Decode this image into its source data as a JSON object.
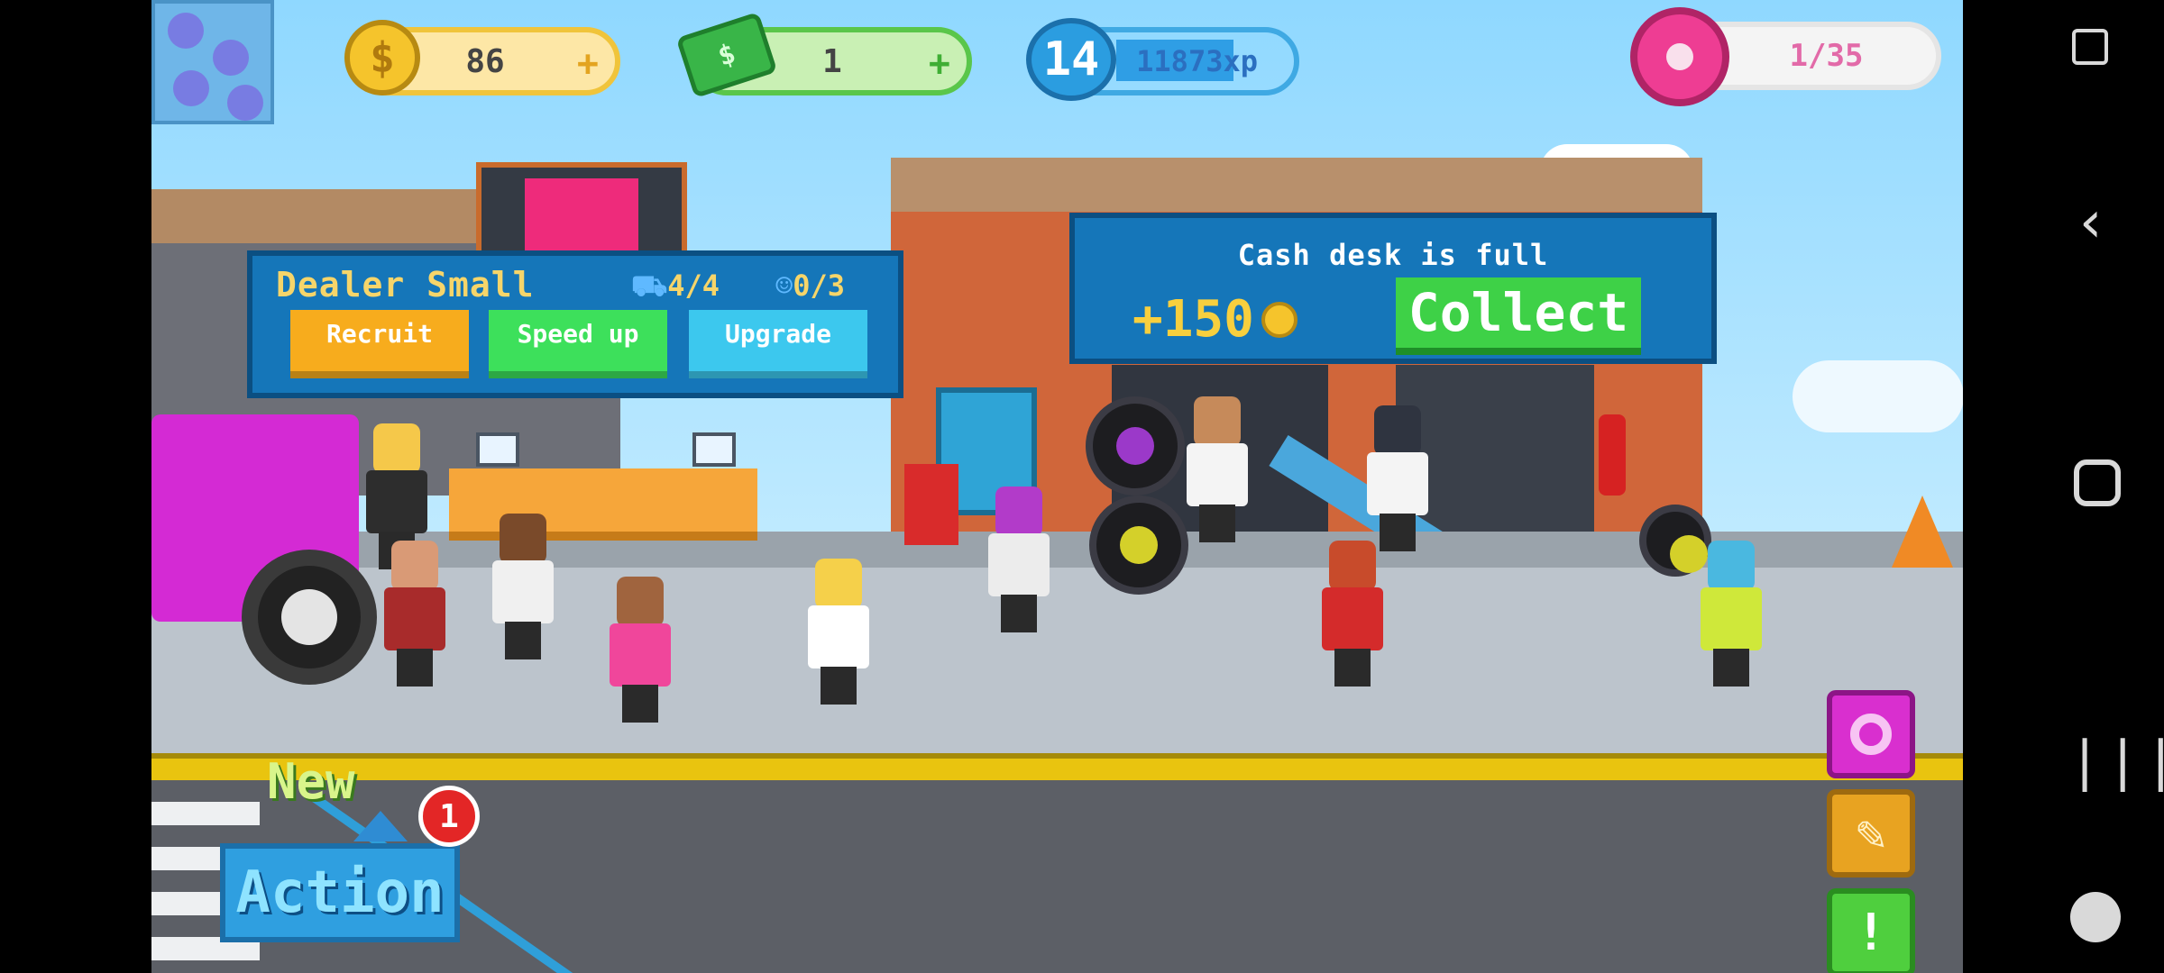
{
  "hud": {
    "coins": "86",
    "coins_plus": "+",
    "cash": "1",
    "cash_plus": "+",
    "level": "14",
    "xp": "11873xp",
    "donuts": "1/35"
  },
  "dealer_panel": {
    "title": "Dealer Small",
    "cars": "4/4",
    "staff": "0/3",
    "recruit": "Recruit",
    "speed_up": "Speed up",
    "upgrade": "Upgrade"
  },
  "cash_desk": {
    "title": "Cash desk is full",
    "amount": "+150",
    "collect": "Collect"
  },
  "action": {
    "new_label": "New",
    "badge": "1",
    "label": "Action"
  },
  "side_buttons": {
    "alert": "!"
  },
  "colors": {
    "panel_blue": "#1576b9",
    "recruit": "#f7ac1d",
    "speed_up": "#3de05b",
    "upgrade": "#3cc8ee",
    "collect": "#3ed147",
    "title_gold": "#f6d56a"
  },
  "icons": [
    "coin-icon",
    "cash-bill-icon",
    "level-star-icon",
    "donut-icon",
    "car-icon",
    "staff-icon",
    "wrench-icon",
    "alert-icon",
    "back-icon",
    "home-icon",
    "recents-icon",
    "game-controller-icon"
  ]
}
